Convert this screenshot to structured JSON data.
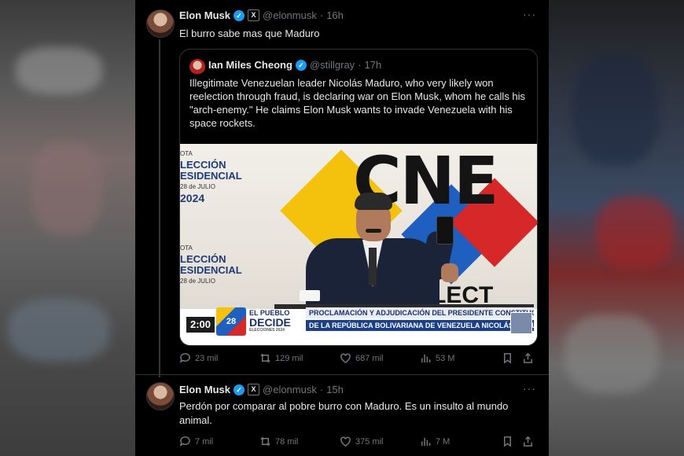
{
  "tweet1": {
    "author_name": "Elon Musk",
    "handle": "@elonmusk",
    "separator": "·",
    "time": "16h",
    "text": "El burro sabe mas que Maduro",
    "more": "···",
    "stats": {
      "replies": "23 mil",
      "reposts": "129 mil",
      "likes": "687 mil",
      "views": "53 M"
    }
  },
  "quote": {
    "author_name": "Ian Miles Cheong",
    "handle": "@stillgray",
    "separator": "·",
    "time": "17h",
    "text": "Illegitimate Venezuelan leader Nicolás Maduro, who very likely won reelection through fraud, is declaring war on Elon Musk, whom he calls his \"arch-enemy.\" He claims Elon Musk wants to invade Venezuela with his space rockets."
  },
  "media": {
    "poster1": {
      "top": "OTA",
      "line1": "LECCIÓN",
      "line2": "ESIDENCIAL",
      "date": "28 de JULIO",
      "year": "2024"
    },
    "poster2": {
      "top": "OTA",
      "line1": "LECCIÓN",
      "line2": "ESIDENCIAL",
      "date": "28 de JULIO"
    },
    "backdrop_letters": "CNE",
    "backdrop_word": "ELECT",
    "lower_third": {
      "clock": "2:00",
      "logo_text": "28",
      "pueblo_line1": "EL PUEBLO",
      "pueblo_line2": "DECIDE",
      "pueblo_line3": "ELECCIONES 2024",
      "headline1": "PROCLAMACIÓN Y ADJUDICACIÓN DEL PRESIDENTE CONSTITUCIONAL",
      "headline2": "DE LA REPÚBLICA BOLIVARIANA DE VENEZUELA NICOLÁS MADURO"
    }
  },
  "tweet2": {
    "author_name": "Elon Musk",
    "handle": "@elonmusk",
    "separator": "·",
    "time": "15h",
    "text": "Perdón por comparar al pobre burro con Maduro. Es un insulto al mundo animal.",
    "more": "···",
    "stats": {
      "replies": "7 mil",
      "reposts": "78 mil",
      "likes": "375 mil",
      "views": "7 M"
    }
  },
  "icons": {
    "verified": "verified-badge-icon",
    "affiliate": "x-affiliate-icon",
    "reply": "reply-icon",
    "repost": "repost-icon",
    "like": "heart-icon",
    "views": "views-chart-icon",
    "bookmark": "bookmark-icon",
    "share": "share-icon"
  },
  "colors": {
    "background": "#000000",
    "accent": "#1d9bf0",
    "muted": "#71767b",
    "text": "#e7e9ea",
    "border": "#2f3336"
  }
}
